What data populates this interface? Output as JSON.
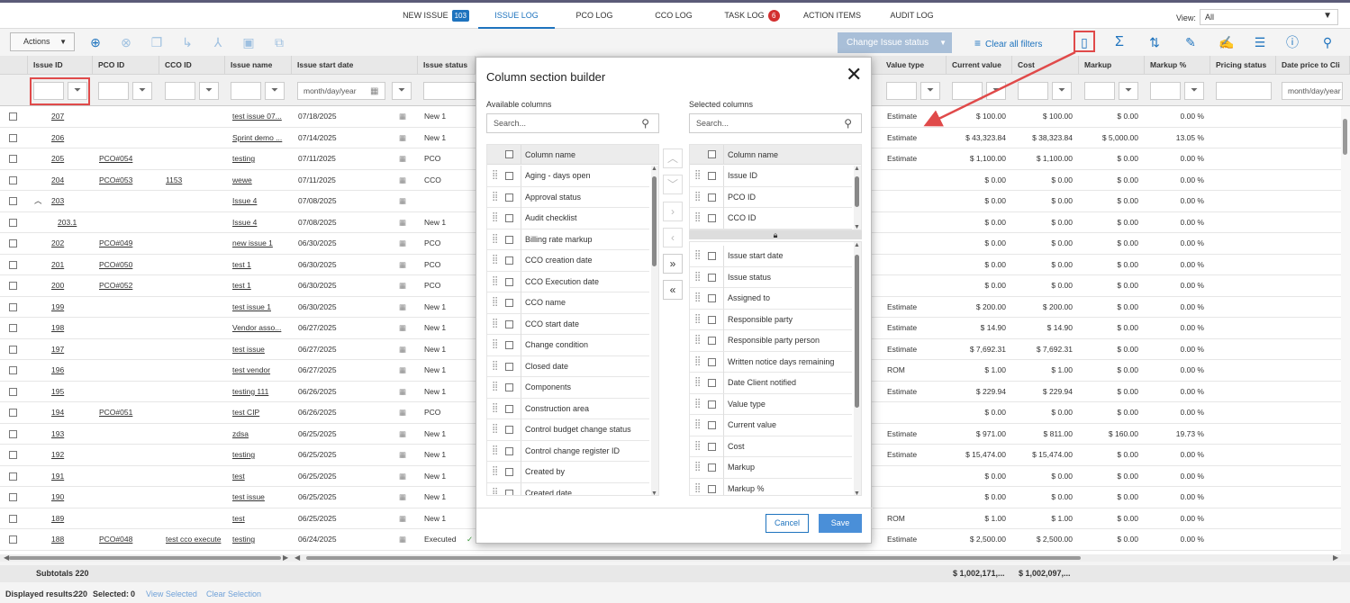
{
  "tabs": [
    {
      "label": "NEW ISSUE",
      "badge": "103",
      "active": false
    },
    {
      "label": "ISSUE LOG",
      "active": true
    },
    {
      "label": "PCO LOG",
      "active": false
    },
    {
      "label": "CCO LOG",
      "active": false
    },
    {
      "label": "TASK LOG",
      "badge": "6",
      "active": false
    },
    {
      "label": "ACTION ITEMS",
      "active": false
    },
    {
      "label": "AUDIT LOG",
      "active": false
    }
  ],
  "view": {
    "label": "View:",
    "value": "All"
  },
  "toolbar": {
    "actions_label": "Actions",
    "change_status_label": "Change Issue status",
    "clear_filters_label": "Clear all filters"
  },
  "columns": [
    "Issue ID",
    "PCO ID",
    "CCO ID",
    "Issue name",
    "Issue start date",
    "Issue status",
    "Value type",
    "Current value",
    "Cost",
    "Markup",
    "Markup %",
    "Pricing status",
    "Date price to Cli"
  ],
  "filter": {
    "date_placeholder": "month/day/year"
  },
  "rows": [
    {
      "id": "207",
      "pco": "",
      "cco": "",
      "name": "test issue 07...",
      "date": "07/18/2025",
      "status": "New 1",
      "vtype": "Estimate",
      "current": "$ 100.00",
      "cost": "$ 100.00",
      "markup": "$ 0.00",
      "pct": "0.00 %"
    },
    {
      "id": "206",
      "pco": "",
      "cco": "",
      "name": "Sprint demo ...",
      "date": "07/14/2025",
      "status": "New 1",
      "vtype": "Estimate",
      "current": "$ 43,323.84",
      "cost": "$ 38,323.84",
      "markup": "$ 5,000.00",
      "pct": "13.05 %"
    },
    {
      "id": "205",
      "pco": "PCO#054",
      "cco": "",
      "name": "testing",
      "date": "07/11/2025",
      "status": "PCO",
      "vtype": "Estimate",
      "current": "$ 1,100.00",
      "cost": "$ 1,100.00",
      "markup": "$ 0.00",
      "pct": "0.00 %"
    },
    {
      "id": "204",
      "pco": "PCO#053",
      "cco": "1153",
      "name": "wewe",
      "date": "07/11/2025",
      "status": "CCO",
      "vtype": "",
      "current": "$ 0.00",
      "cost": "$ 0.00",
      "markup": "$ 0.00",
      "pct": "0.00 %"
    },
    {
      "id": "203",
      "pco": "",
      "cco": "",
      "name": "Issue 4",
      "date": "07/08/2025",
      "status": "",
      "vtype": "",
      "current": "$ 0.00",
      "cost": "$ 0.00",
      "markup": "$ 0.00",
      "pct": "0.00 %",
      "expand": true
    },
    {
      "id": "203.1",
      "pco": "",
      "cco": "",
      "name": "Issue 4",
      "date": "07/08/2025",
      "status": "New 1",
      "vtype": "",
      "current": "$ 0.00",
      "cost": "$ 0.00",
      "markup": "$ 0.00",
      "pct": "0.00 %",
      "child": true
    },
    {
      "id": "202",
      "pco": "PCO#049",
      "cco": "",
      "name": "new issue 1",
      "date": "06/30/2025",
      "status": "PCO",
      "vtype": "",
      "current": "$ 0.00",
      "cost": "$ 0.00",
      "markup": "$ 0.00",
      "pct": "0.00 %"
    },
    {
      "id": "201",
      "pco": "PCO#050",
      "cco": "",
      "name": "test 1",
      "date": "06/30/2025",
      "status": "PCO",
      "vtype": "",
      "current": "$ 0.00",
      "cost": "$ 0.00",
      "markup": "$ 0.00",
      "pct": "0.00 %"
    },
    {
      "id": "200",
      "pco": "PCO#052",
      "cco": "",
      "name": "test 1",
      "date": "06/30/2025",
      "status": "PCO",
      "vtype": "",
      "current": "$ 0.00",
      "cost": "$ 0.00",
      "markup": "$ 0.00",
      "pct": "0.00 %"
    },
    {
      "id": "199",
      "pco": "",
      "cco": "",
      "name": "test issue 1",
      "date": "06/30/2025",
      "status": "New 1",
      "vtype": "Estimate",
      "current": "$ 200.00",
      "cost": "$ 200.00",
      "markup": "$ 0.00",
      "pct": "0.00 %"
    },
    {
      "id": "198",
      "pco": "",
      "cco": "",
      "name": "Vendor asso...",
      "date": "06/27/2025",
      "status": "New 1",
      "vtype": "Estimate",
      "current": "$ 14.90",
      "cost": "$ 14.90",
      "markup": "$ 0.00",
      "pct": "0.00 %"
    },
    {
      "id": "197",
      "pco": "",
      "cco": "",
      "name": "test issue",
      "date": "06/27/2025",
      "status": "New 1",
      "vtype": "Estimate",
      "current": "$ 7,692.31",
      "cost": "$ 7,692.31",
      "markup": "$ 0.00",
      "pct": "0.00 %"
    },
    {
      "id": "196",
      "pco": "",
      "cco": "",
      "name": "test vendor",
      "date": "06/27/2025",
      "status": "New 1",
      "vtype": "ROM",
      "current": "$ 1.00",
      "cost": "$ 1.00",
      "markup": "$ 0.00",
      "pct": "0.00 %"
    },
    {
      "id": "195",
      "pco": "",
      "cco": "",
      "name": "testing 111",
      "date": "06/26/2025",
      "status": "New 1",
      "vtype": "Estimate",
      "current": "$ 229.94",
      "cost": "$ 229.94",
      "markup": "$ 0.00",
      "pct": "0.00 %"
    },
    {
      "id": "194",
      "pco": "PCO#051",
      "cco": "",
      "name": "test CIP",
      "date": "06/26/2025",
      "status": "PCO",
      "vtype": "",
      "current": "$ 0.00",
      "cost": "$ 0.00",
      "markup": "$ 0.00",
      "pct": "0.00 %"
    },
    {
      "id": "193",
      "pco": "",
      "cco": "",
      "name": "zdsa",
      "date": "06/25/2025",
      "status": "New 1",
      "vtype": "Estimate",
      "current": "$ 971.00",
      "cost": "$ 811.00",
      "markup": "$ 160.00",
      "pct": "19.73 %"
    },
    {
      "id": "192",
      "pco": "",
      "cco": "",
      "name": "testing",
      "date": "06/25/2025",
      "status": "New 1",
      "vtype": "Estimate",
      "current": "$ 15,474.00",
      "cost": "$ 15,474.00",
      "markup": "$ 0.00",
      "pct": "0.00 %"
    },
    {
      "id": "191",
      "pco": "",
      "cco": "",
      "name": "test",
      "date": "06/25/2025",
      "status": "New 1",
      "vtype": "",
      "current": "$ 0.00",
      "cost": "$ 0.00",
      "markup": "$ 0.00",
      "pct": "0.00 %"
    },
    {
      "id": "190",
      "pco": "",
      "cco": "",
      "name": "test issue",
      "date": "06/25/2025",
      "status": "New 1",
      "vtype": "",
      "current": "$ 0.00",
      "cost": "$ 0.00",
      "markup": "$ 0.00",
      "pct": "0.00 %"
    },
    {
      "id": "189",
      "pco": "",
      "cco": "",
      "name": "test",
      "date": "06/25/2025",
      "status": "New 1",
      "vtype": "ROM",
      "current": "$ 1.00",
      "cost": "$ 1.00",
      "markup": "$ 0.00",
      "pct": "0.00 %"
    },
    {
      "id": "188",
      "pco": "PCO#048",
      "cco": "test cco execute",
      "name": "testing",
      "date": "06/24/2025",
      "status": "Executed",
      "vtype": "Estimate",
      "current": "$ 2,500.00",
      "cost": "$ 2,500.00",
      "markup": "$ 0.00",
      "pct": "0.00 %"
    }
  ],
  "subtotals": {
    "label": "Subtotals 220",
    "current": "$ 1,002,171,...",
    "cost": "$ 1,002,097,..."
  },
  "footer": {
    "displayed_label": "Displayed results:",
    "displayed_value": "220",
    "selected_label": "Selected:",
    "selected_value": "0",
    "view_selected": "View Selected",
    "clear_selection": "Clear Selection"
  },
  "modal": {
    "title": "Column section builder",
    "available_label": "Available columns",
    "selected_label": "Selected columns",
    "search_placeholder": "Search...",
    "column_header": "Column name",
    "available": [
      "Aging - days open",
      "Approval status",
      "Audit checklist",
      "Billing rate markup",
      "CCO creation date",
      "CCO Execution date",
      "CCO name",
      "CCO start date",
      "Change condition",
      "Closed date",
      "Components",
      "Construction area",
      "Control budget change status",
      "Control change register ID",
      "Created by",
      "Created date"
    ],
    "locked": [
      "Issue ID",
      "PCO ID",
      "CCO ID"
    ],
    "selected": [
      "Issue start date",
      "Issue status",
      "Assigned to",
      "Responsible party",
      "Responsible party person",
      "Written notice days remaining",
      "Date Client notified",
      "Value type",
      "Current value",
      "Cost",
      "Markup",
      "Markup %"
    ],
    "cancel_label": "Cancel",
    "save_label": "Save"
  },
  "colors": {
    "accent": "#1e73be",
    "highlight": "#e04a4a",
    "badge_red": "#d32f2f"
  }
}
